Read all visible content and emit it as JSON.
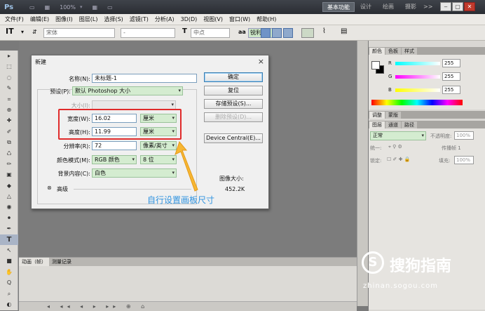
{
  "app": {
    "logo": "Ps",
    "zoom": "100%",
    "workspaces": [
      "基本功能",
      "设计",
      "绘画",
      "摄影"
    ],
    "more": ">>",
    "win_controls": [
      "‒",
      "▢",
      "✕"
    ]
  },
  "menu": [
    "文件(F)",
    "编辑(E)",
    "图像(I)",
    "图层(L)",
    "选择(S)",
    "滤镜(T)",
    "分析(A)",
    "3D(D)",
    "视图(V)",
    "窗口(W)",
    "帮助(H)"
  ],
  "options": {
    "font_family": "宋体",
    "font_style": "-",
    "font_size": "中点",
    "aa_label": "aa",
    "antialias": "锐利"
  },
  "tools": [
    "▸",
    "⬚",
    "◌",
    "✎",
    "⌗",
    "⊕",
    "✚",
    "✐",
    "⧉",
    "♺",
    "✏",
    "▣",
    "◆",
    "△",
    "◉",
    "⚫",
    "✒",
    "T",
    "↖",
    "■",
    "✋",
    "Q",
    "⌕",
    "◐"
  ],
  "dialog": {
    "title": "新建",
    "close": "×",
    "name_label": "名称(N):",
    "name_value": "未标题-1",
    "preset_label": "预设(P):",
    "preset_value": "默认 Photoshop 大小",
    "size_label": "大小(I):",
    "width_label": "宽度(W):",
    "width_value": "16.02",
    "width_unit": "厘米",
    "height_label": "高度(H):",
    "height_value": "11.99",
    "height_unit": "厘米",
    "resolution_label": "分辨率(R):",
    "resolution_value": "72",
    "resolution_unit": "像素/英寸",
    "color_mode_label": "颜色模式(M):",
    "color_mode_value": "RGB 颜色",
    "bit_depth": "8 位",
    "bg_label": "背景内容(C):",
    "bg_value": "白色",
    "advanced": "高级",
    "buttons": [
      "确定",
      "复位",
      "存储预设(S)...",
      "删除预设(D)...",
      "Device Central(E)..."
    ],
    "image_size_label": "图像大小:",
    "image_size_value": "452.2K"
  },
  "annotation": "自行设置画板尺寸",
  "panels": {
    "color_tabs": [
      "颜色",
      "色板",
      "样式"
    ],
    "r_label": "R",
    "g_label": "G",
    "b_label": "B",
    "r_value": "255",
    "g_value": "255",
    "b_value": "255",
    "adjust_tabs": [
      "调整",
      "蒙版"
    ],
    "layer_tabs": [
      "图层",
      "通道",
      "路径"
    ],
    "blend_mode": "正常",
    "opacity_label": "不透明度:",
    "opacity_value": "100%",
    "lock_label": "锁定:",
    "fill_label": "填充:",
    "fill_value": "100%",
    "propagate_label": "传播帧 1"
  },
  "bottom": {
    "tabs": [
      "动画（帧）",
      "测量记录"
    ],
    "controls": "◂ ◂◂ ◂ ▸ ▸▸ ⊕ ⌂"
  },
  "watermark": {
    "logo": "S",
    "brand": "搜狗指南",
    "url": "zhinan.sogou.com"
  },
  "colors": {
    "red_highlight": "#e02b2b",
    "annotation_blue": "#2f93e0",
    "green_select": "#d4ecd0"
  }
}
